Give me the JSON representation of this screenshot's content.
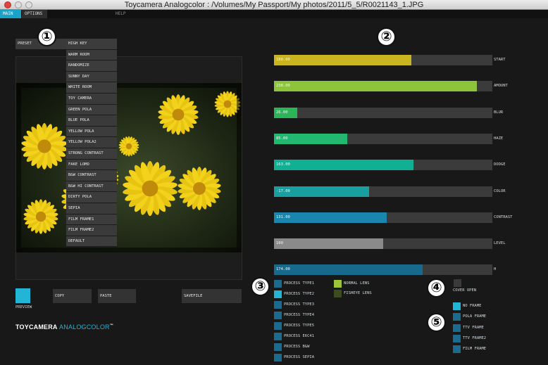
{
  "window": {
    "title": "Toycamera Analogcolor : /Volumes/My Passport/My photos/2011/5_5/R0021143_1.JPG"
  },
  "menu": {
    "main": "MAIN",
    "options": "OPTIONS",
    "help": "HELP"
  },
  "preset": {
    "label": "PRESET",
    "items": [
      "HIGH KEY",
      "WARM ROOM",
      "RANDOMIZE",
      "SUNNY DAY",
      "WHITE ROOM",
      "TOY CAMERA",
      "GREEN POLA",
      "BLUE POLA",
      "YELLOW POLA",
      "YELLOW POLA2",
      "STRONG CONTRAST",
      "FAKE LOMO",
      "B&W CONTRAST",
      "B&W HI CONTRAST",
      "DIRTY POLA",
      "SEPIA",
      "FILM FRAME1",
      "FILM FRAME2",
      "DEFAULT"
    ]
  },
  "buttons": {
    "preview": "PREVIEW",
    "copy": "COPY",
    "paste": "PASTE",
    "savefile": "SAVEFILE"
  },
  "brand": {
    "part1": "TOYCAMERA ",
    "part2": "ANALOGCOLOR",
    "tm": "™"
  },
  "markers": [
    "①",
    "②",
    "③",
    "④",
    "⑤"
  ],
  "sliders": [
    {
      "label": "START",
      "value": "180.00",
      "level": 0.63,
      "color": "#c9b520"
    },
    {
      "label": "AMOUNT",
      "value": "238.00",
      "level": 0.93,
      "color": "#8cc43a"
    },
    {
      "label": "BLUR",
      "value": "26.00",
      "level": 0.105,
      "color": "#2cb458"
    },
    {
      "label": "HAZE",
      "value": "85.00",
      "level": 0.335,
      "color": "#22b870"
    },
    {
      "label": "DODGE",
      "value": "163.00",
      "level": 0.64,
      "color": "#10b095"
    },
    {
      "label": "COLOR",
      "value": "-17.00",
      "level": 0.435,
      "color": "#18a0a0"
    },
    {
      "label": "CONTRAST",
      "value": "131.00",
      "level": 0.515,
      "color": "#1a86ad"
    },
    {
      "label": "LEVEL",
      "value": "100",
      "level": 0.5,
      "color": "#8a8a8a"
    },
    {
      "label": "H",
      "value": "174.00",
      "level": 0.68,
      "color": "#176a8c"
    }
  ],
  "process_types": [
    {
      "label": "PROCESS TYPE1",
      "on": false
    },
    {
      "label": "PROCESS TYPE2",
      "on": true
    },
    {
      "label": "PROCESS TYPE3",
      "on": false
    },
    {
      "label": "PROCESS TYPE4",
      "on": false
    },
    {
      "label": "PROCESS TYPE5",
      "on": false
    },
    {
      "label": "PROCESS E6C41",
      "on": false
    },
    {
      "label": "PROCESS B&W",
      "on": false
    },
    {
      "label": "PROCESS SEPIA",
      "on": false
    }
  ],
  "lenses": [
    {
      "label": "NORMAL LENS",
      "on": true,
      "color": "#9cc43a"
    },
    {
      "label": "FISHEYE LENS",
      "on": false,
      "color": "#3d4a22"
    }
  ],
  "cover_open": {
    "label": "COVER OPEN"
  },
  "frames": [
    {
      "label": "NO FRAME",
      "on": true
    },
    {
      "label": "POLA FRAME",
      "on": false
    },
    {
      "label": "TTV FRAME",
      "on": false
    },
    {
      "label": "TTV FRAME2",
      "on": false
    },
    {
      "label": "FILM FRAME",
      "on": false
    }
  ],
  "colors": {
    "accent": "#23b5d6",
    "toggle_off": "#1b6b8e"
  }
}
